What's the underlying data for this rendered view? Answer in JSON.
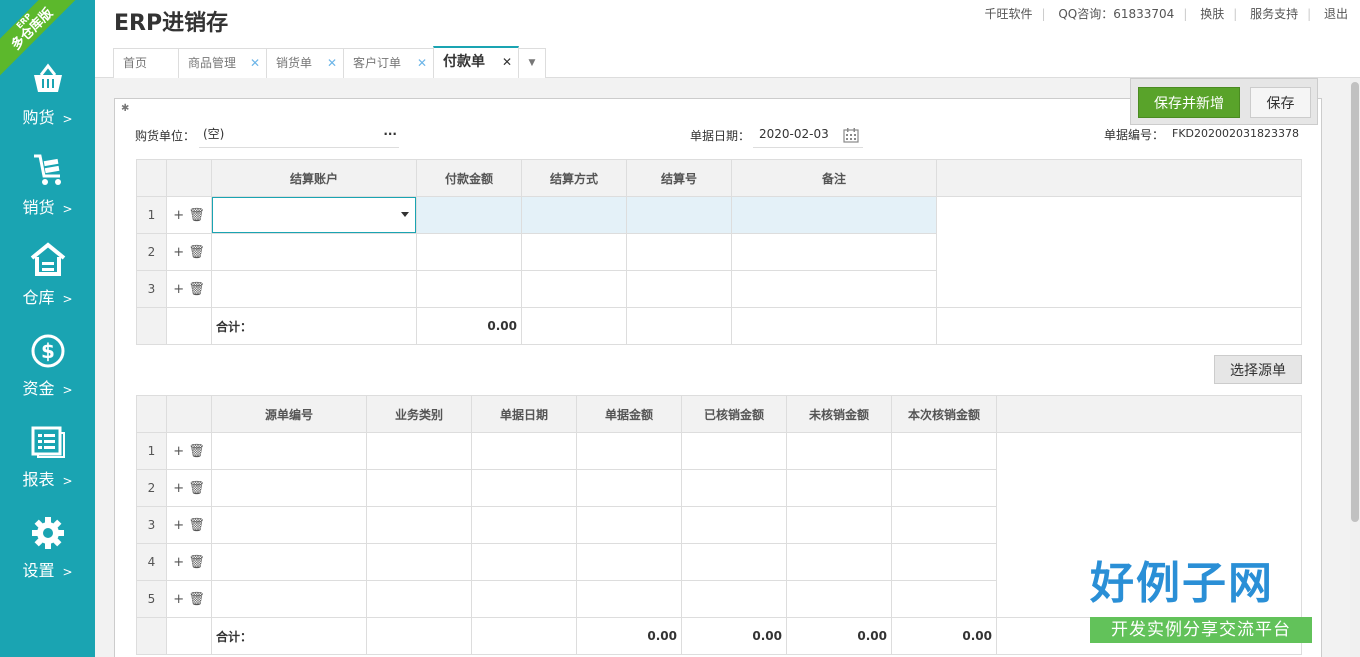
{
  "ribbon": {
    "top": "ERP",
    "main": "多仓库版"
  },
  "sidebar": {
    "items": [
      {
        "label": "购货",
        "icon": "basket-icon",
        "arrow": ">"
      },
      {
        "label": "销货",
        "icon": "cart-icon",
        "arrow": ">"
      },
      {
        "label": "仓库",
        "icon": "house-icon",
        "arrow": ">"
      },
      {
        "label": "资金",
        "icon": "dollar-icon",
        "arrow": ">"
      },
      {
        "label": "报表",
        "icon": "report-icon",
        "arrow": ">"
      },
      {
        "label": "设置",
        "icon": "gear-icon",
        "arrow": ">"
      }
    ]
  },
  "header": {
    "title": "ERP进销存",
    "links": [
      "千旺软件",
      "QQ咨询：61833704",
      "换肤",
      "服务支持",
      "退出"
    ]
  },
  "tabs": [
    {
      "label": "首页",
      "closable": false
    },
    {
      "label": "商品管理",
      "closable": true
    },
    {
      "label": "销货单",
      "closable": true
    },
    {
      "label": "客户订单",
      "closable": true
    },
    {
      "label": "付款单",
      "closable": true,
      "active": true
    }
  ],
  "toolbar": {
    "save_new_label": "保存并新增",
    "save_label": "保存"
  },
  "form": {
    "supplier_label": "购货单位：",
    "supplier_value": "(空)",
    "supplier_more": "···",
    "date_label": "单据日期：",
    "date_value": "2020-02-03",
    "docno_label": "单据编号：",
    "docno_value": "FKD202002031823378"
  },
  "settlement_grid": {
    "columns": [
      "结算账户",
      "付款金额",
      "结算方式",
      "结算号",
      "备注"
    ],
    "rows": [
      1,
      2,
      3
    ],
    "total_label": "合计：",
    "total_amount": "0.00"
  },
  "choose_source_label": "选择源单",
  "source_grid": {
    "columns": [
      "源单编号",
      "业务类别",
      "单据日期",
      "单据金额",
      "已核销金额",
      "未核销金额",
      "本次核销金额"
    ],
    "rows": [
      1,
      2,
      3,
      4,
      5
    ],
    "total_label": "合计：",
    "totals": [
      "0.00",
      "0.00",
      "0.00",
      "0.00"
    ]
  },
  "ops": {
    "add": "+",
    "delete": "🗑"
  },
  "logo": {
    "title": "好例子网",
    "subtitle": "开发实例分享交流平台"
  },
  "colors": {
    "sidebar": "#1aa4b2",
    "save_new": "#59a32a",
    "ribbon": "#5cb82c",
    "highlight_row": "#e4f1f8"
  }
}
